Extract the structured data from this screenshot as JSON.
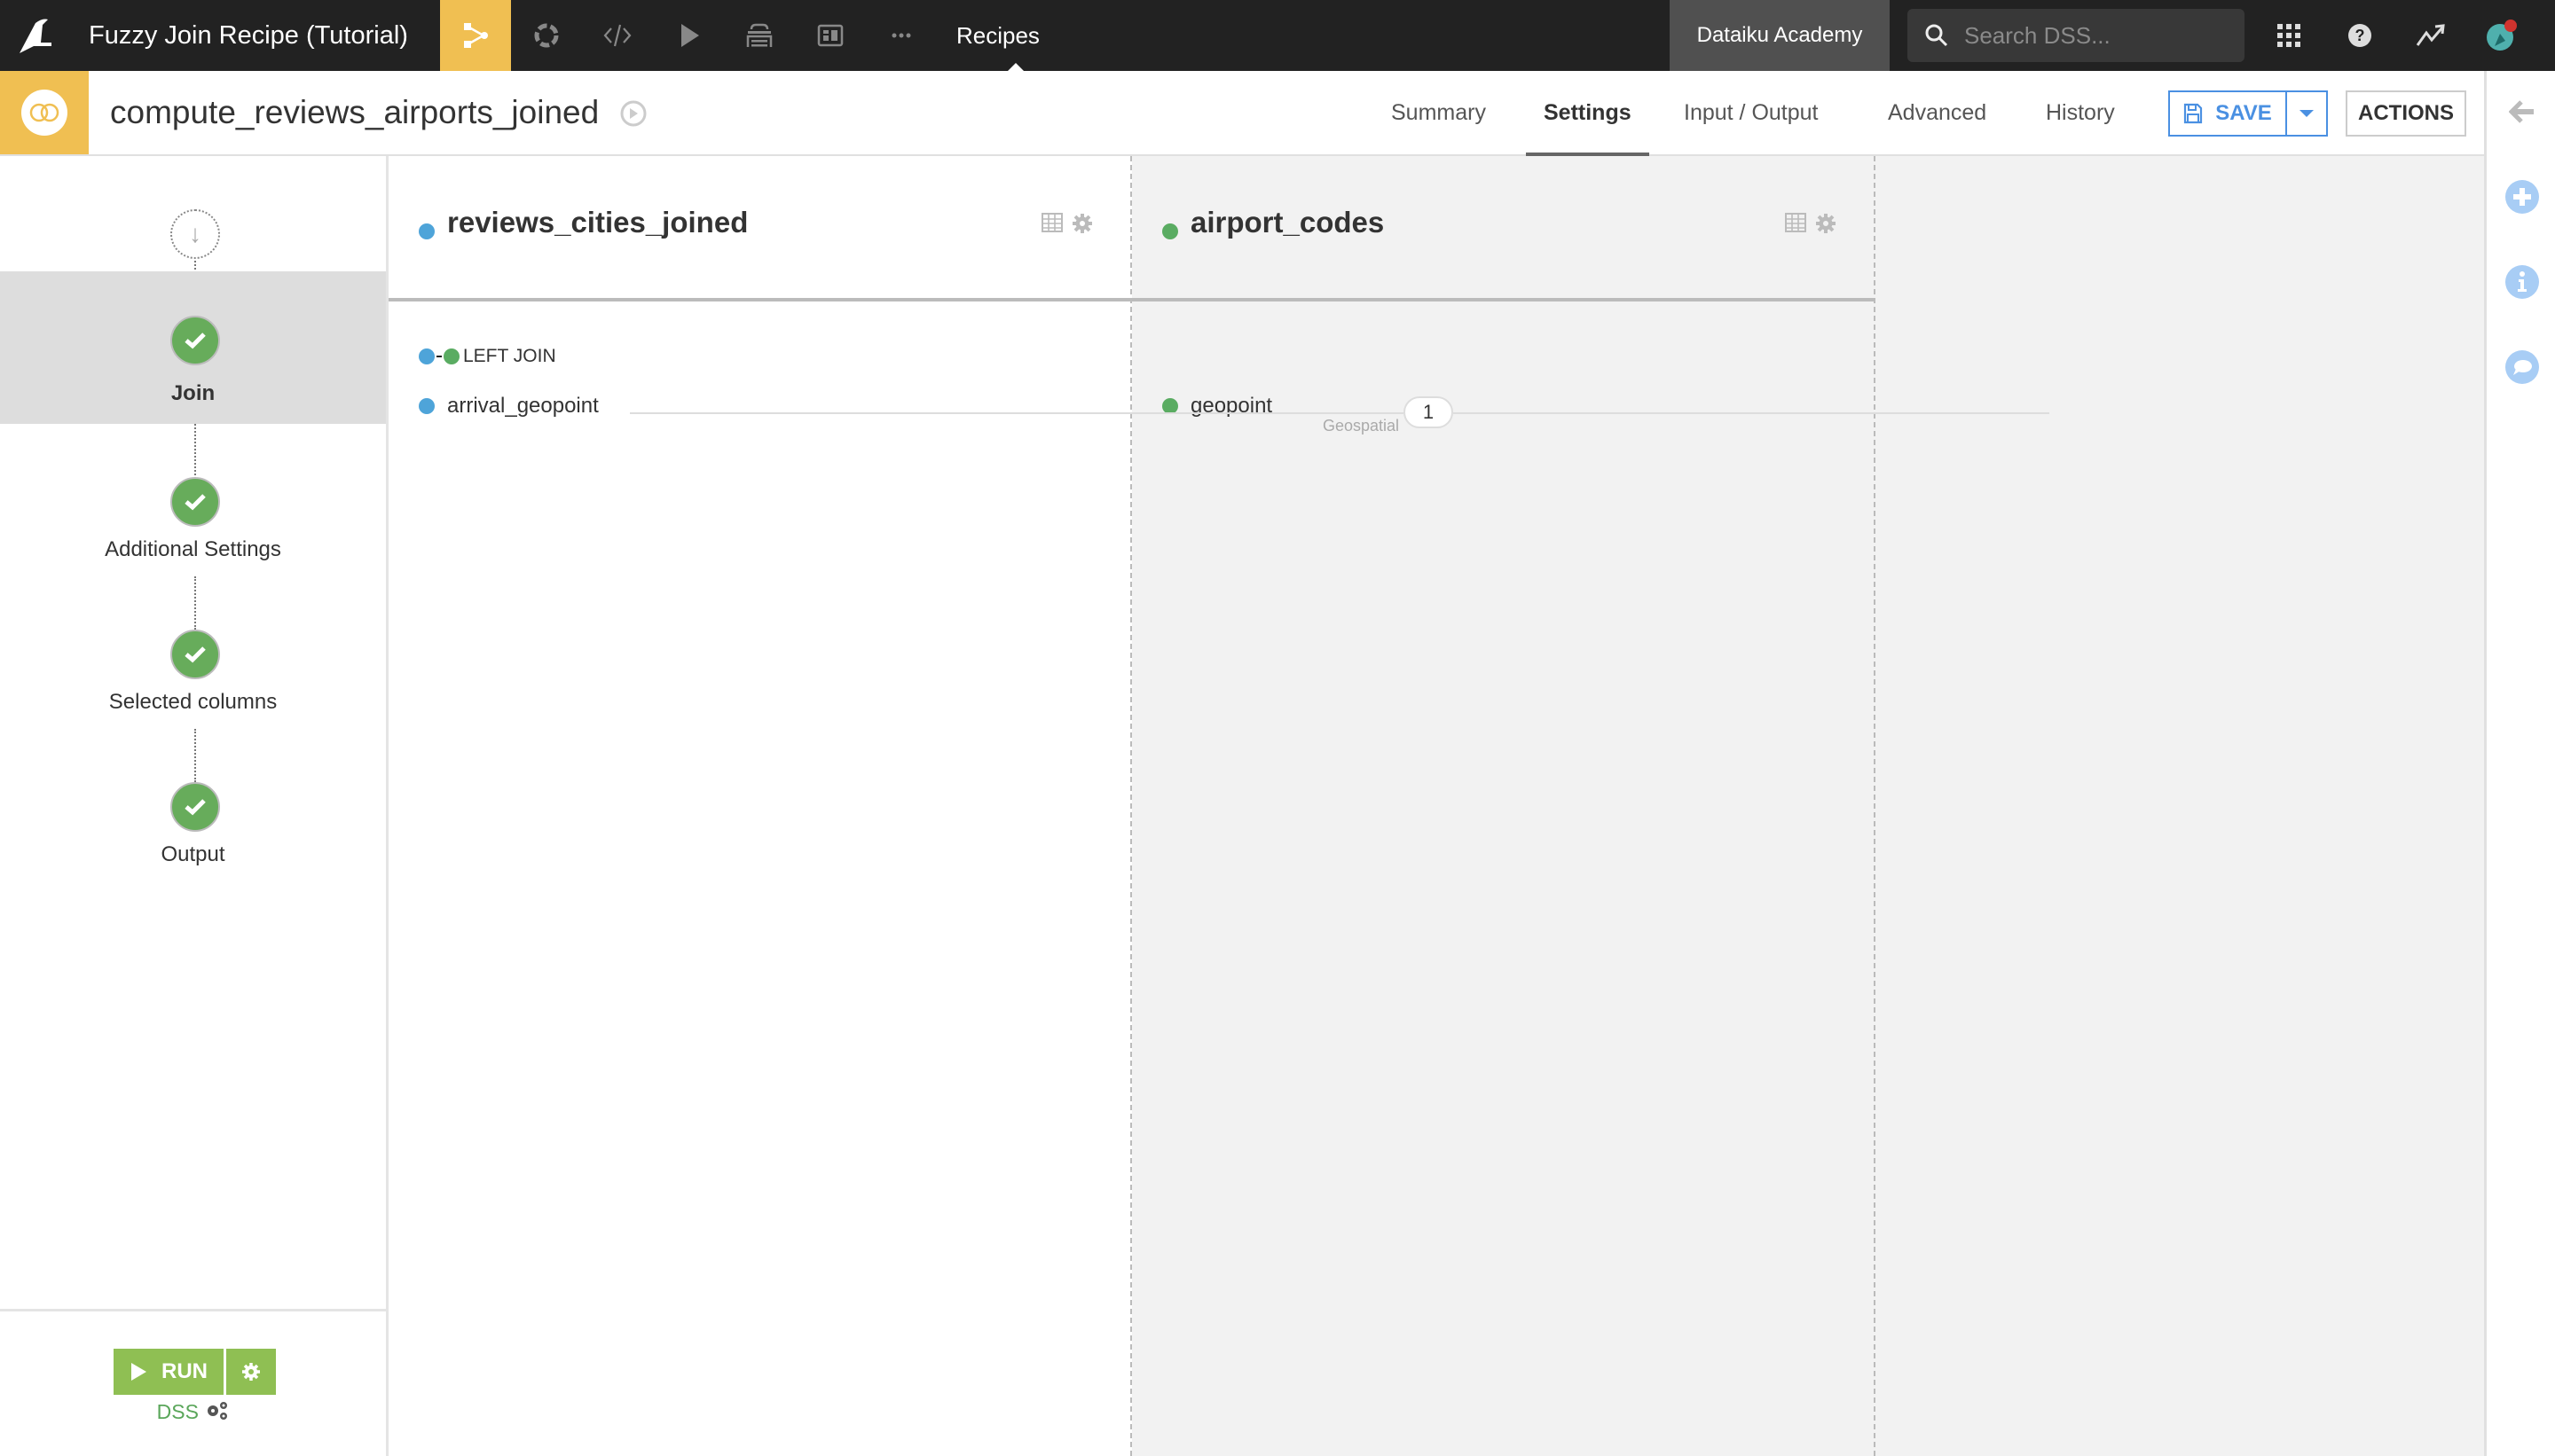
{
  "topbar": {
    "project_title": "Fuzzy Join Recipe (Tutorial)",
    "nav_icons": [
      "flow-icon",
      "jobs-icon",
      "code-icon",
      "run-icon",
      "datasets-icon",
      "dashboard-icon",
      "more-icon"
    ],
    "active_section": "Recipes",
    "instance_name": "Dataiku Academy",
    "search_placeholder": "Search DSS...",
    "right_icons": [
      "apps-grid-icon",
      "help-icon",
      "activity-icon",
      "avatar"
    ],
    "notification_dot": true
  },
  "recipe": {
    "name": "compute_reviews_airports_joined",
    "tabs": [
      {
        "label": "Summary",
        "active": false
      },
      {
        "label": "Settings",
        "active": true
      },
      {
        "label": "Input / Output",
        "active": false
      },
      {
        "label": "Advanced",
        "active": false
      },
      {
        "label": "History",
        "active": false
      }
    ],
    "save_label": "SAVE",
    "actions_label": "ACTIONS"
  },
  "steps": [
    {
      "label": "Join",
      "status": "done",
      "active": true
    },
    {
      "label": "Additional Settings",
      "status": "done",
      "active": false
    },
    {
      "label": "Selected columns",
      "status": "done",
      "active": false
    },
    {
      "label": "Output",
      "status": "done",
      "active": false
    }
  ],
  "run": {
    "label": "RUN",
    "engine": "DSS"
  },
  "join": {
    "left_dataset": {
      "name": "reviews_cities_joined",
      "color": "#4ea4d9"
    },
    "right_dataset": {
      "name": "airport_codes",
      "color": "#5aac62"
    },
    "join_type": "LEFT JOIN",
    "conditions": [
      {
        "left_column": "arrival_geopoint",
        "right_column": "geopoint",
        "count": "1",
        "type": "Geospatial"
      }
    ]
  },
  "colors": {
    "accent_yellow": "#f0bf52",
    "save_blue": "#4a90e2",
    "run_green": "#8fbf53",
    "step_green": "#67ac5b"
  }
}
